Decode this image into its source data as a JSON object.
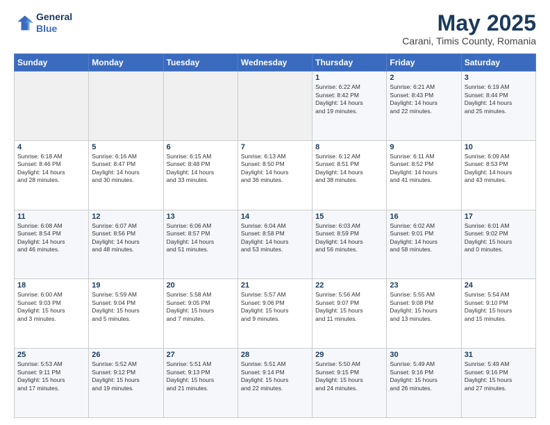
{
  "logo": {
    "line1": "General",
    "line2": "Blue"
  },
  "title": "May 2025",
  "subtitle": "Carani, Timis County, Romania",
  "days_header": [
    "Sunday",
    "Monday",
    "Tuesday",
    "Wednesday",
    "Thursday",
    "Friday",
    "Saturday"
  ],
  "weeks": [
    [
      {
        "day": "",
        "info": ""
      },
      {
        "day": "",
        "info": ""
      },
      {
        "day": "",
        "info": ""
      },
      {
        "day": "",
        "info": ""
      },
      {
        "day": "1",
        "info": "Sunrise: 6:22 AM\nSunset: 8:42 PM\nDaylight: 14 hours\nand 19 minutes."
      },
      {
        "day": "2",
        "info": "Sunrise: 6:21 AM\nSunset: 8:43 PM\nDaylight: 14 hours\nand 22 minutes."
      },
      {
        "day": "3",
        "info": "Sunrise: 6:19 AM\nSunset: 8:44 PM\nDaylight: 14 hours\nand 25 minutes."
      }
    ],
    [
      {
        "day": "4",
        "info": "Sunrise: 6:18 AM\nSunset: 8:46 PM\nDaylight: 14 hours\nand 28 minutes."
      },
      {
        "day": "5",
        "info": "Sunrise: 6:16 AM\nSunset: 8:47 PM\nDaylight: 14 hours\nand 30 minutes."
      },
      {
        "day": "6",
        "info": "Sunrise: 6:15 AM\nSunset: 8:48 PM\nDaylight: 14 hours\nand 33 minutes."
      },
      {
        "day": "7",
        "info": "Sunrise: 6:13 AM\nSunset: 8:50 PM\nDaylight: 14 hours\nand 36 minutes."
      },
      {
        "day": "8",
        "info": "Sunrise: 6:12 AM\nSunset: 8:51 PM\nDaylight: 14 hours\nand 38 minutes."
      },
      {
        "day": "9",
        "info": "Sunrise: 6:11 AM\nSunset: 8:52 PM\nDaylight: 14 hours\nand 41 minutes."
      },
      {
        "day": "10",
        "info": "Sunrise: 6:09 AM\nSunset: 8:53 PM\nDaylight: 14 hours\nand 43 minutes."
      }
    ],
    [
      {
        "day": "11",
        "info": "Sunrise: 6:08 AM\nSunset: 8:54 PM\nDaylight: 14 hours\nand 46 minutes."
      },
      {
        "day": "12",
        "info": "Sunrise: 6:07 AM\nSunset: 8:56 PM\nDaylight: 14 hours\nand 48 minutes."
      },
      {
        "day": "13",
        "info": "Sunrise: 6:06 AM\nSunset: 8:57 PM\nDaylight: 14 hours\nand 51 minutes."
      },
      {
        "day": "14",
        "info": "Sunrise: 6:04 AM\nSunset: 8:58 PM\nDaylight: 14 hours\nand 53 minutes."
      },
      {
        "day": "15",
        "info": "Sunrise: 6:03 AM\nSunset: 8:59 PM\nDaylight: 14 hours\nand 56 minutes."
      },
      {
        "day": "16",
        "info": "Sunrise: 6:02 AM\nSunset: 9:01 PM\nDaylight: 14 hours\nand 58 minutes."
      },
      {
        "day": "17",
        "info": "Sunrise: 6:01 AM\nSunset: 9:02 PM\nDaylight: 15 hours\nand 0 minutes."
      }
    ],
    [
      {
        "day": "18",
        "info": "Sunrise: 6:00 AM\nSunset: 9:03 PM\nDaylight: 15 hours\nand 3 minutes."
      },
      {
        "day": "19",
        "info": "Sunrise: 5:59 AM\nSunset: 9:04 PM\nDaylight: 15 hours\nand 5 minutes."
      },
      {
        "day": "20",
        "info": "Sunrise: 5:58 AM\nSunset: 9:05 PM\nDaylight: 15 hours\nand 7 minutes."
      },
      {
        "day": "21",
        "info": "Sunrise: 5:57 AM\nSunset: 9:06 PM\nDaylight: 15 hours\nand 9 minutes."
      },
      {
        "day": "22",
        "info": "Sunrise: 5:56 AM\nSunset: 9:07 PM\nDaylight: 15 hours\nand 11 minutes."
      },
      {
        "day": "23",
        "info": "Sunrise: 5:55 AM\nSunset: 9:08 PM\nDaylight: 15 hours\nand 13 minutes."
      },
      {
        "day": "24",
        "info": "Sunrise: 5:54 AM\nSunset: 9:10 PM\nDaylight: 15 hours\nand 15 minutes."
      }
    ],
    [
      {
        "day": "25",
        "info": "Sunrise: 5:53 AM\nSunset: 9:11 PM\nDaylight: 15 hours\nand 17 minutes."
      },
      {
        "day": "26",
        "info": "Sunrise: 5:52 AM\nSunset: 9:12 PM\nDaylight: 15 hours\nand 19 minutes."
      },
      {
        "day": "27",
        "info": "Sunrise: 5:51 AM\nSunset: 9:13 PM\nDaylight: 15 hours\nand 21 minutes."
      },
      {
        "day": "28",
        "info": "Sunrise: 5:51 AM\nSunset: 9:14 PM\nDaylight: 15 hours\nand 22 minutes."
      },
      {
        "day": "29",
        "info": "Sunrise: 5:50 AM\nSunset: 9:15 PM\nDaylight: 15 hours\nand 24 minutes."
      },
      {
        "day": "30",
        "info": "Sunrise: 5:49 AM\nSunset: 9:16 PM\nDaylight: 15 hours\nand 26 minutes."
      },
      {
        "day": "31",
        "info": "Sunrise: 5:49 AM\nSunset: 9:16 PM\nDaylight: 15 hours\nand 27 minutes."
      }
    ]
  ]
}
